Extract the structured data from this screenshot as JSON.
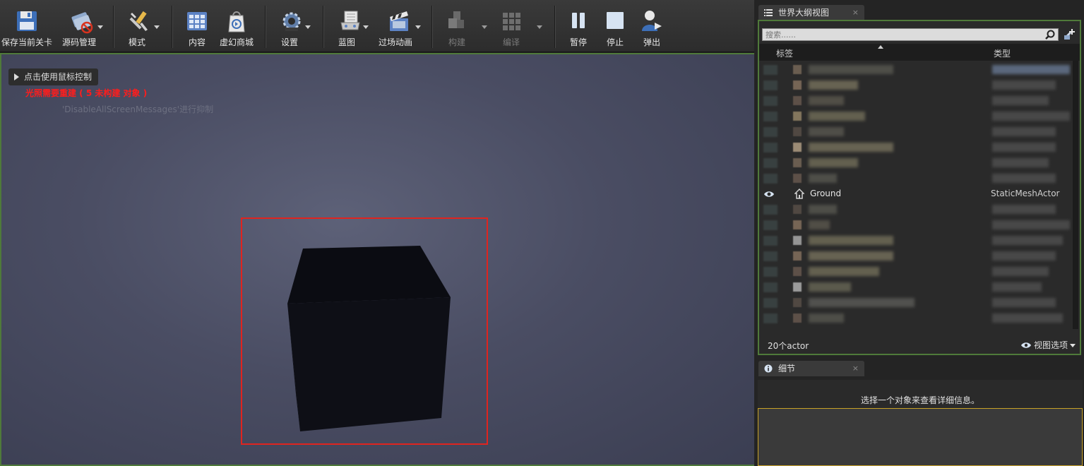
{
  "toolbar": {
    "buttons": [
      {
        "label": "保存当前关卡",
        "icon": "save-icon"
      },
      {
        "label": "源码管理",
        "icon": "source-control-icon"
      },
      {
        "label": "模式",
        "icon": "modes-icon"
      },
      {
        "label": "内容",
        "icon": "content-icon"
      },
      {
        "label": "虚幻商城",
        "icon": "marketplace-icon"
      },
      {
        "label": "设置",
        "icon": "settings-icon"
      },
      {
        "label": "蓝图",
        "icon": "blueprint-icon"
      },
      {
        "label": "过场动画",
        "icon": "cinematics-icon"
      },
      {
        "label": "构建",
        "icon": "build-icon"
      },
      {
        "label": "编译",
        "icon": "compile-icon"
      },
      {
        "label": "暂停",
        "icon": "pause-icon"
      },
      {
        "label": "停止",
        "icon": "stop-icon"
      },
      {
        "label": "弹出",
        "icon": "eject-icon"
      }
    ]
  },
  "viewport": {
    "control_hint": "点击使用鼠标控制",
    "lighting_warning": "光照需要重建 ( 5 未构建 对象 )",
    "suppress_hint": "'DisableAllScreenMessages'进行抑制"
  },
  "outliner": {
    "tab_title": "世界大纲视图",
    "tab_close": "×",
    "search_placeholder": "搜索......",
    "column_label": "标签",
    "column_type": "类型",
    "ground_row": {
      "name": "Ground",
      "type": "StaticMeshActor"
    },
    "actor_count": "20个actor",
    "view_options": "视图选项"
  },
  "details": {
    "tab_title": "细节",
    "tab_close": "×",
    "empty_message": "选择一个对象来查看详细信息。"
  },
  "colors": {
    "panel_focus_border": "#4f7a3a",
    "warning_red": "#ff1d1d",
    "highlight_red": "#e0241f",
    "details_border": "#c9a227"
  }
}
